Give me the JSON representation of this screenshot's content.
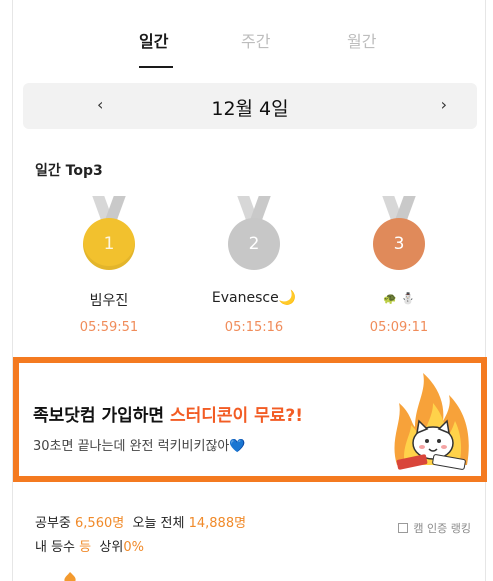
{
  "tabs": [
    {
      "label": "일간",
      "active": true
    },
    {
      "label": "주간",
      "active": false
    },
    {
      "label": "월간",
      "active": false
    }
  ],
  "date_nav": {
    "prev": "‹",
    "date": "12월 4일",
    "next": "›"
  },
  "section_title": "일간 Top3",
  "top3": [
    {
      "rank": "1",
      "name": "빔우진",
      "time": "05:59:51",
      "medal": "gold"
    },
    {
      "rank": "2",
      "name": "Evanesce",
      "time": "05:15:16",
      "medal": "silver"
    },
    {
      "rank": "3",
      "name": "",
      "time": "05:09:11",
      "medal": "bronze"
    }
  ],
  "banner": {
    "title_prefix": "족보닷컴 가입하면 ",
    "title_highlight": "스터디콘이 무료?!",
    "subtitle": "30초면 끝나는데 완전 럭키비키잖아💙"
  },
  "stats": {
    "studying_label": "공부중",
    "studying_count": "6,560명",
    "today_label": "오늘 전체",
    "today_count": "14,888명",
    "my_rank_label": "내 등수",
    "my_rank": "등",
    "top_label": "상위",
    "top_percent": "0%"
  },
  "cert_ranking_label": "캠 인증 랭킹",
  "colors": {
    "accent": "#f47a20",
    "highlight": "#f25c24",
    "time": "#f08c5a",
    "gold": "#f2c12e",
    "silver": "#c7c7c7",
    "bronze": "#e08a5a"
  }
}
